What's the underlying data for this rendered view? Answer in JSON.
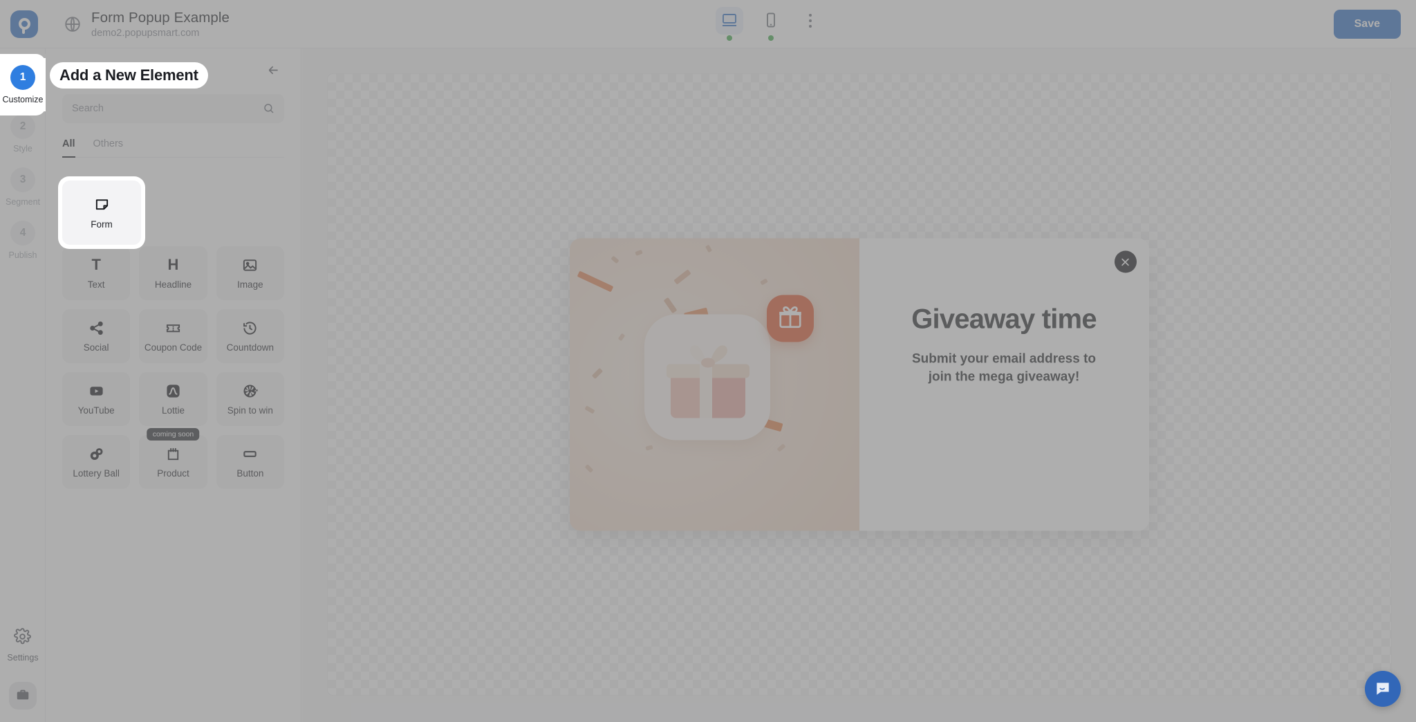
{
  "header": {
    "logo_icon": "popupsmart-logo",
    "globe_icon": "globe-icon",
    "site_title": "Form Popup Example",
    "site_url": "demo2.popupsmart.com",
    "devices": [
      {
        "id": "desktop",
        "icon": "desktop-icon",
        "active": true,
        "status_dot": "green"
      },
      {
        "id": "mobile",
        "icon": "mobile-icon",
        "active": false,
        "status_dot": "green"
      }
    ],
    "more_icon": "kebab-menu-icon",
    "save_label": "Save",
    "accent_color": "#2f6fc4"
  },
  "rail": {
    "steps": [
      {
        "num": "1",
        "label": "Customize",
        "active": true
      },
      {
        "num": "2",
        "label": "Style",
        "active": false
      },
      {
        "num": "3",
        "label": "Segment",
        "active": false
      },
      {
        "num": "4",
        "label": "Publish",
        "active": false
      }
    ],
    "settings_label": "Settings",
    "settings_icon": "gear-icon",
    "briefcase_icon": "briefcase-icon"
  },
  "panel": {
    "title": "Add a New Element",
    "back_icon": "arrow-left-icon",
    "search": {
      "value": "",
      "placeholder": "Search",
      "icon": "search-icon"
    },
    "tabs": [
      {
        "label": "All",
        "active": true
      },
      {
        "label": "Others",
        "active": false
      }
    ],
    "featured": {
      "label": "Form",
      "icon": "form-icon"
    },
    "elements": [
      {
        "label": "Text",
        "icon": "text-icon",
        "glyph": "T"
      },
      {
        "label": "Headline",
        "icon": "headline-icon",
        "glyph": "H"
      },
      {
        "label": "Image",
        "icon": "image-icon"
      },
      {
        "label": "Social",
        "icon": "share-icon"
      },
      {
        "label": "Coupon Code",
        "icon": "ticket-icon"
      },
      {
        "label": "Countdown",
        "icon": "clock-rewind-icon"
      },
      {
        "label": "YouTube",
        "icon": "youtube-icon"
      },
      {
        "label": "Lottie",
        "icon": "lottie-icon"
      },
      {
        "label": "Spin to win",
        "icon": "wheel-icon"
      },
      {
        "label": "Lottery Ball",
        "icon": "lottery-ball-icon"
      },
      {
        "label": "Product",
        "icon": "product-icon",
        "badge": "coming soon"
      },
      {
        "label": "Button",
        "icon": "button-icon"
      }
    ]
  },
  "canvas": {
    "popup": {
      "close_icon": "close-icon",
      "badge_icon": "gift-icon",
      "heading": "Giveaway time",
      "subheading_line1": "Submit your email address to",
      "subheading_line2": "join the mega giveaway!",
      "image_bg_color": "#eed4c1",
      "badge_color": "#e0542a"
    }
  },
  "chat": {
    "icon": "chat-bubble-icon",
    "color": "#3267b8"
  }
}
